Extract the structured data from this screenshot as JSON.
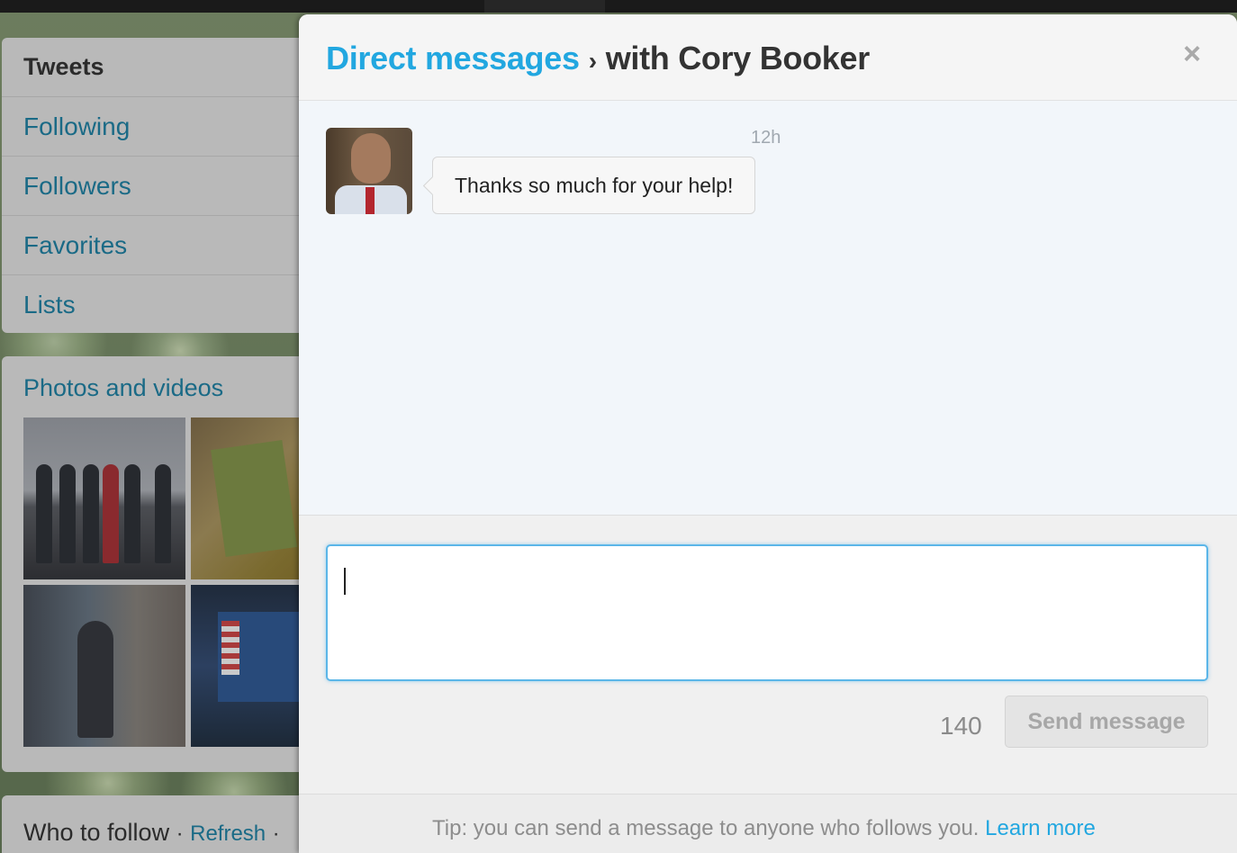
{
  "background": {
    "nav": {
      "items": [
        {
          "label": "Tweets"
        },
        {
          "label": "Following"
        },
        {
          "label": "Followers"
        },
        {
          "label": "Favorites"
        },
        {
          "label": "Lists"
        }
      ]
    },
    "photos": {
      "title": "Photos and videos"
    },
    "who_to_follow": {
      "title": "Who to follow",
      "separator": "·",
      "refresh": "Refresh",
      "trailing_dot": "·"
    }
  },
  "modal": {
    "title_link": "Direct messages",
    "title_separator": "›",
    "title_with": "with Cory Booker",
    "close_icon": "close-icon",
    "conversation": {
      "messages": [
        {
          "time": "12h",
          "text": "Thanks so much for your help!"
        }
      ]
    },
    "composer": {
      "value": "",
      "char_count": "140",
      "send_label": "Send message"
    },
    "footer": {
      "tip": "Tip: you can send a message to anyone who follows you.",
      "learn_more": "Learn more"
    }
  },
  "colors": {
    "accent": "#22a7e0",
    "input_focus": "#5bb6e8",
    "dimmed_link": "#1a6a86"
  }
}
